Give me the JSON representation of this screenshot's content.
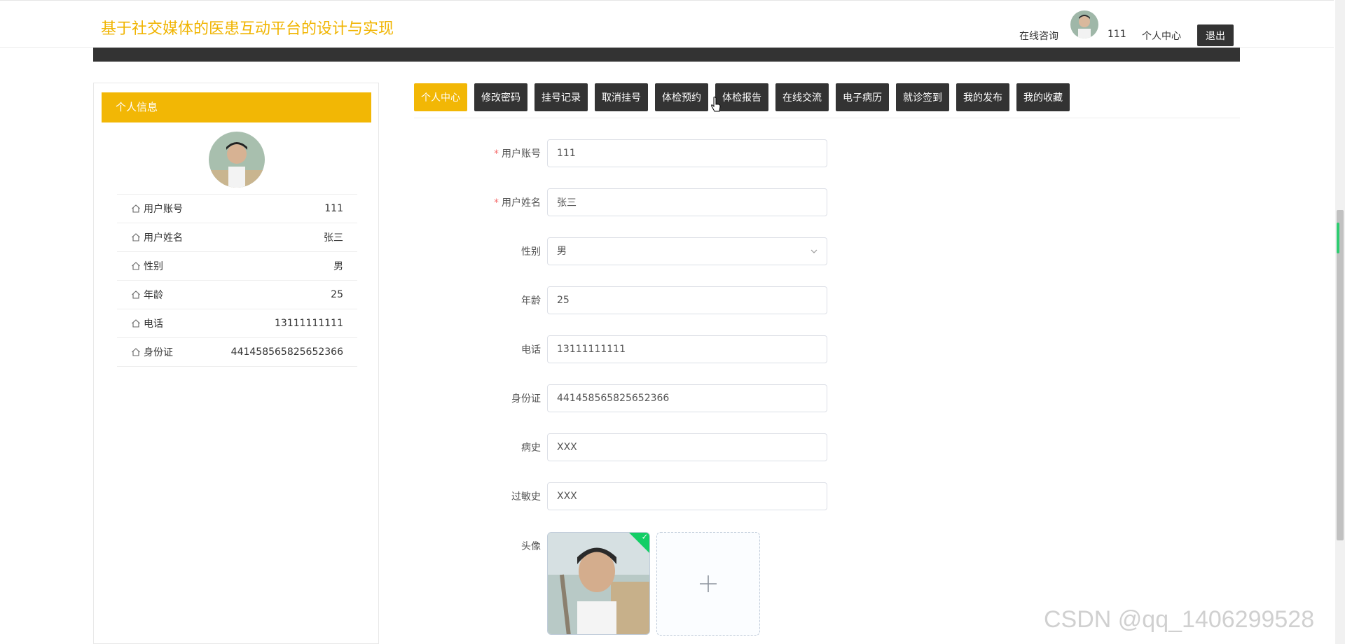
{
  "header": {
    "site_title": "基于社交媒体的医患互动平台的设计与实现",
    "nav_consult": "在线咨询",
    "username": "111",
    "nav_personal_center": "个人中心",
    "logout_label": "退出"
  },
  "sidebar": {
    "title": "个人信息",
    "fields": [
      {
        "label": "用户账号",
        "value": "111"
      },
      {
        "label": "用户姓名",
        "value": "张三"
      },
      {
        "label": "性别",
        "value": "男"
      },
      {
        "label": "年龄",
        "value": "25"
      },
      {
        "label": "电话",
        "value": "13111111111"
      },
      {
        "label": "身份证",
        "value": "441458565825652366"
      }
    ]
  },
  "tabs": [
    {
      "label": "个人中心",
      "active": true
    },
    {
      "label": "修改密码"
    },
    {
      "label": "挂号记录"
    },
    {
      "label": "取消挂号"
    },
    {
      "label": "体检预约"
    },
    {
      "label": "体检报告"
    },
    {
      "label": "在线交流"
    },
    {
      "label": "电子病历"
    },
    {
      "label": "就诊签到"
    },
    {
      "label": "我的发布"
    },
    {
      "label": "我的收藏"
    }
  ],
  "form": {
    "account": {
      "label": "用户账号",
      "value": "111",
      "required": true
    },
    "name": {
      "label": "用户姓名",
      "value": "张三",
      "required": true
    },
    "gender": {
      "label": "性别",
      "value": "男"
    },
    "age": {
      "label": "年龄",
      "value": "25"
    },
    "phone": {
      "label": "电话",
      "value": "13111111111"
    },
    "id_card": {
      "label": "身份证",
      "value": "441458565825652366"
    },
    "history": {
      "label": "病史",
      "value": "XXX"
    },
    "allergy": {
      "label": "过敏史",
      "value": "XXX"
    },
    "avatar": {
      "label": "头像"
    },
    "required_mark": "*"
  },
  "watermark": "CSDN @qq_1406299528",
  "colors": {
    "accent": "#f2b705",
    "dark": "#333333",
    "success": "#13ce66"
  }
}
